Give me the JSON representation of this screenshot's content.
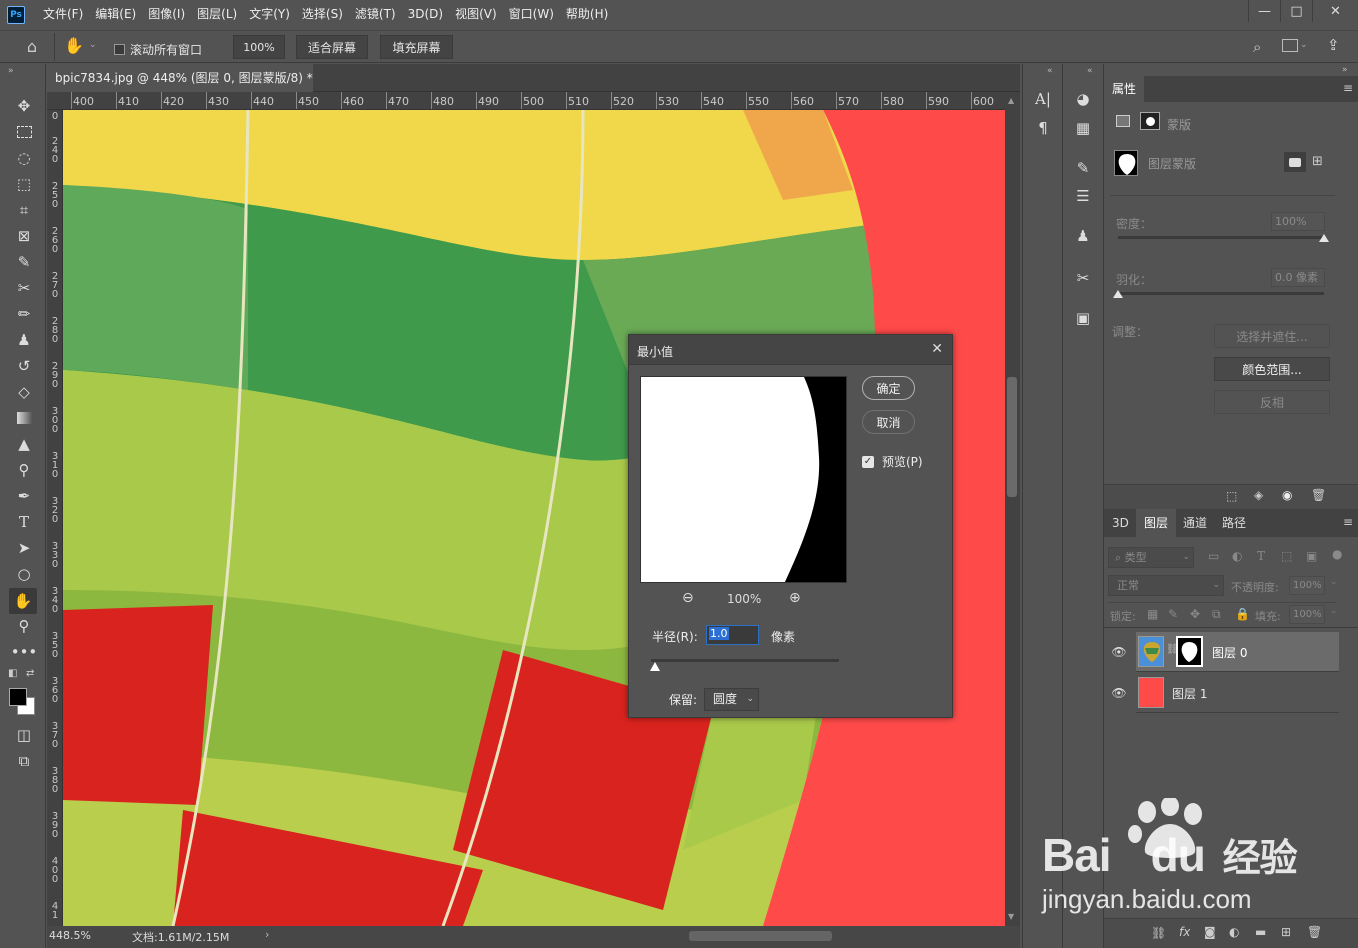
{
  "app": {
    "logo": "Ps"
  },
  "menu": [
    "文件(F)",
    "编辑(E)",
    "图像(I)",
    "图层(L)",
    "文字(Y)",
    "选择(S)",
    "滤镜(T)",
    "3D(D)",
    "视图(V)",
    "窗口(W)",
    "帮助(H)"
  ],
  "window_controls": {
    "minimize": "—",
    "maximize": "□",
    "close": "✕"
  },
  "options": {
    "scroll_all": "滚动所有窗口",
    "zoom_100": "100%",
    "fit_screen": "适合屏幕",
    "fill_screen": "填充屏幕"
  },
  "document": {
    "tab_title": "bpic7834.jpg @ 448% (图层 0, 图层蒙版/8) *",
    "tab_close": "×",
    "ruler_h": [
      "400",
      "410",
      "420",
      "430",
      "440",
      "450",
      "460",
      "470",
      "480",
      "490",
      "500",
      "510",
      "520",
      "530",
      "540",
      "550",
      "560",
      "570",
      "580",
      "590",
      "600"
    ],
    "ruler_v": [
      "0",
      "2\n4\n0",
      "2\n5\n0",
      "2\n6\n0",
      "2\n7\n0",
      "2\n8\n0",
      "2\n9\n0",
      "3\n0\n0",
      "3\n1\n0",
      "3\n2\n0",
      "3\n3\n0",
      "3\n4\n0",
      "3\n5\n0",
      "3\n6\n0",
      "3\n7\n0",
      "3\n8\n0",
      "3\n9\n0",
      "4\n0\n0",
      "4\n1"
    ],
    "status_zoom": "448.5%",
    "status_doc": "文档:1.61M/2.15M",
    "status_arrow": "›",
    "colors": {
      "red_bg": "#ff4a4a",
      "yellow": "#f1d84a",
      "green": "#3f9a4b",
      "lime": "#a9c94b",
      "red": "#d9231e"
    }
  },
  "properties": {
    "tab": "属性",
    "mask_label": "蒙版",
    "layer_mask_label": "图层蒙版",
    "density_label": "密度：",
    "density_value": "100%",
    "density_level": 1.0,
    "feather_label": "羽化：",
    "feather_value": "0.0 像素",
    "feather_level": 0.0,
    "adjust_label": "调整：",
    "select_mask_btn": "选择并遮住...",
    "color_range_btn": "颜色范围...",
    "invert_btn": "反相"
  },
  "layers_panel": {
    "tabs": [
      "3D",
      "图层",
      "通道",
      "路径"
    ],
    "active_tab": "图层",
    "filter_label": "类型",
    "blend_mode": "正常",
    "opacity_label": "不透明度:",
    "opacity_value": "100%",
    "lock_label": "锁定:",
    "fill_label": "填充:",
    "fill_value": "100%",
    "layers": [
      {
        "name": "图层 0",
        "visible": true,
        "selected": true
      },
      {
        "name": "图层 1",
        "visible": true,
        "selected": false
      }
    ]
  },
  "dialog": {
    "title": "最小值",
    "close": "✕",
    "ok": "确定",
    "cancel": "取消",
    "preview_label": "预览(P)",
    "preview_checked": true,
    "zoom_level": "100%",
    "radius_label": "半径(R):",
    "radius_value": "1.0",
    "radius_unit": "像素",
    "preserve_label": "保留:",
    "preserve_value": "圆度"
  },
  "watermark": {
    "brand_a": "Bai",
    "brand_b": "du",
    "brand_cn": "经验",
    "url": "jingyan.baidu.com"
  }
}
